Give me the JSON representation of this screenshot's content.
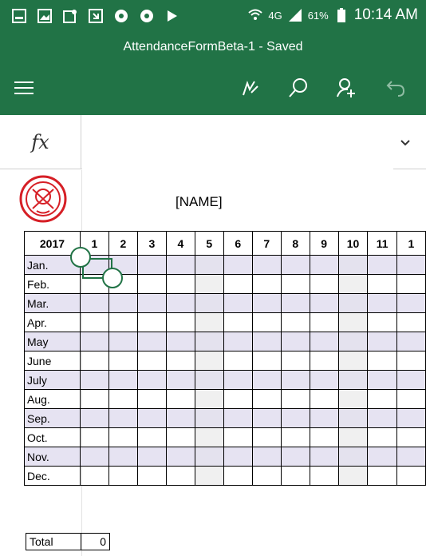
{
  "status_bar": {
    "network": "4G",
    "battery": "61%",
    "time": "10:14 AM"
  },
  "title_bar": {
    "title": "AttendanceFormBeta-1 - Saved",
    "menu_icon": "hamburger-icon",
    "actions": [
      "pen-icon",
      "search-icon",
      "share-person-icon",
      "undo-icon"
    ]
  },
  "formula_bar": {
    "fx_label": "fx",
    "value": ""
  },
  "sheet": {
    "name_cell": "[NAME]",
    "year_header": "2017",
    "day_headers": [
      "1",
      "2",
      "3",
      "4",
      "5",
      "6",
      "7",
      "8",
      "9",
      "10",
      "11",
      "1"
    ],
    "months": [
      "Jan.",
      "Feb.",
      "Mar.",
      "Apr.",
      "May",
      "June",
      "July",
      "Aug.",
      "Sep.",
      "Oct.",
      "Nov.",
      "Dec."
    ],
    "total_label": "Total",
    "total_value": "0"
  },
  "colors": {
    "accent": "#217346",
    "shaded_row": "#e6e3f2"
  }
}
